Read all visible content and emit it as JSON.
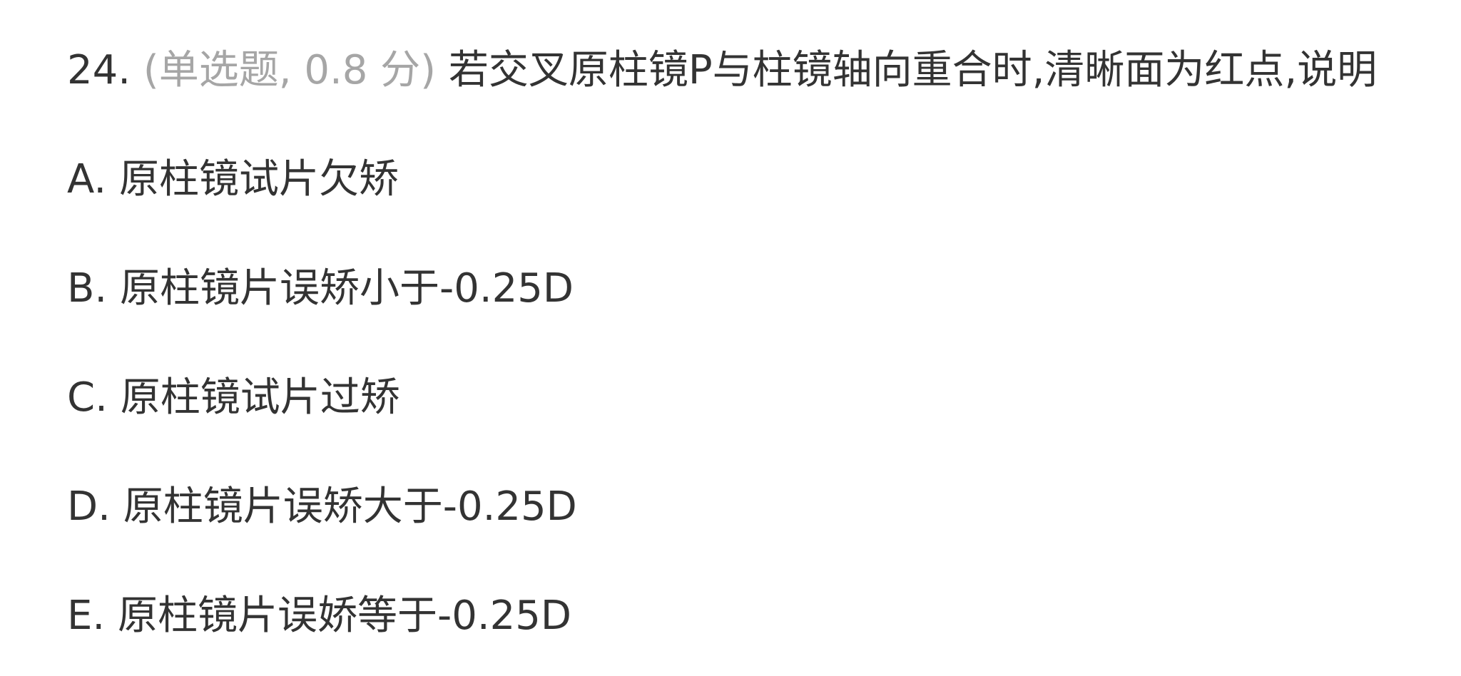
{
  "question": {
    "number": "24.",
    "meta": "(单选题, 0.8 分)",
    "text": "若交叉原柱镜P与柱镜轴向重合时,清晰面为红点,说明"
  },
  "options": [
    {
      "letter": "A.",
      "text": "原柱镜试片欠矫"
    },
    {
      "letter": "B.",
      "text": "原柱镜片误矫小于-0.25D"
    },
    {
      "letter": "C.",
      "text": "原柱镜试片过矫"
    },
    {
      "letter": "D.",
      "text": "原柱镜片误矫大于-0.25D"
    },
    {
      "letter": "E.",
      "text": "原柱镜片误娇等于-0.25D"
    }
  ],
  "colors": {
    "text": "#333333",
    "meta": "#a6a6a6",
    "background": "#ffffff"
  }
}
